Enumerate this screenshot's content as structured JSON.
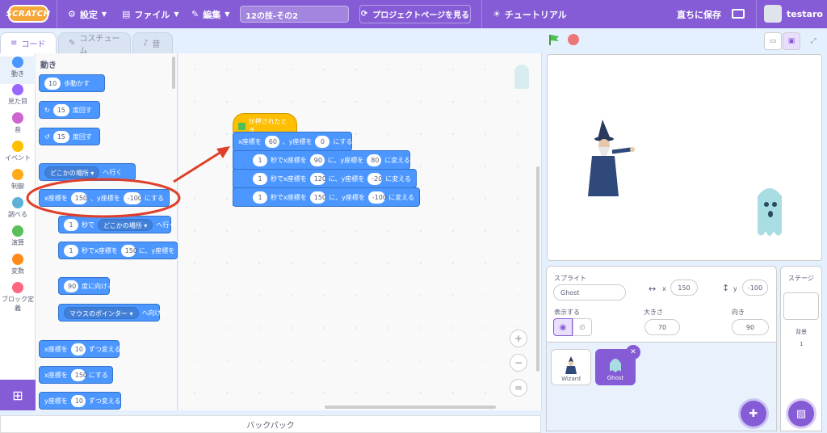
{
  "menubar": {
    "logo": "SCRATCH",
    "settings": "設定",
    "file": "ファイル",
    "edit": "編集",
    "project_title": "12の技-その2",
    "project_page": "プロジェクトページを見る",
    "tutorial": "チュートリアル",
    "save_now": "直ちに保存",
    "username": "testaro"
  },
  "tabs": {
    "code": "コード",
    "costume": "コスチューム",
    "sound": "音"
  },
  "categories": [
    {
      "label": "動き",
      "color": "#4c97ff"
    },
    {
      "label": "見た目",
      "color": "#9966ff"
    },
    {
      "label": "音",
      "color": "#cf63cf"
    },
    {
      "label": "イベント",
      "color": "#ffbf00"
    },
    {
      "label": "制御",
      "color": "#ffab19"
    },
    {
      "label": "調べる",
      "color": "#5cb1d6"
    },
    {
      "label": "演算",
      "color": "#59c059"
    },
    {
      "label": "変数",
      "color": "#ff8c1a"
    },
    {
      "label": "ブロック定義",
      "color": "#ff6680"
    }
  ],
  "palette": {
    "heading": "動き",
    "blocks": {
      "move": {
        "value": "10",
        "text": "歩動かす"
      },
      "turn_right": {
        "value": "15",
        "text": "度回す"
      },
      "turn_left": {
        "value": "15",
        "text": "度回す"
      },
      "goto": {
        "dropdown": "どこかの場所",
        "text": "へ行く"
      },
      "goto_xy": {
        "x_label": "x座標を",
        "x": "150",
        "mid": "、y座標を",
        "y": "-100",
        "end": "にする"
      },
      "glide": {
        "value": "1",
        "text": "秒で",
        "dropdown": "どこかの場所",
        "end": "へ行く"
      },
      "glide_xy": {
        "value": "1",
        "text": "秒でx座標を",
        "x": "150",
        "mid": "に、y座標を"
      },
      "point": {
        "value": "90",
        "text": "度に向ける"
      },
      "point_towards": {
        "dropdown": "マウスのポインター",
        "text": "へ向ける"
      },
      "change_x": {
        "label": "x座標を",
        "value": "10",
        "text": "ずつ変える"
      },
      "set_x": {
        "label": "x座標を",
        "value": "150",
        "text": "にする"
      },
      "change_y": {
        "label": "y座標を",
        "value": "10",
        "text": "ずつ変える"
      }
    }
  },
  "script": {
    "hat": "が押されたとき",
    "goto_xy": {
      "x_label": "x座標を",
      "x": "60",
      "mid": "、y座標を",
      "y": "0",
      "end": "にする"
    },
    "glides": [
      {
        "secs": "1",
        "t1": "秒でx座標を",
        "x": "90",
        "t2": "に、y座標を",
        "y": "80",
        "t3": "に変える"
      },
      {
        "secs": "1",
        "t1": "秒でx座標を",
        "x": "120",
        "t2": "に、y座標を",
        "y": "-20",
        "t3": "に変える"
      },
      {
        "secs": "1",
        "t1": "秒でx座標を",
        "x": "150",
        "t2": "に、y座標を",
        "y": "-100",
        "t3": "に変える"
      }
    ]
  },
  "backpack": "バックパック",
  "sprite_info": {
    "sprite_label": "スプライト",
    "sprite_name": "Ghost",
    "x_label": "x",
    "x": "150",
    "y_label": "y",
    "y": "-100",
    "show_label": "表示する",
    "size_label": "大きさ",
    "size": "70",
    "direction_label": "向き",
    "direction": "90"
  },
  "sprites": [
    {
      "name": "Wizard"
    },
    {
      "name": "Ghost"
    }
  ],
  "stage_panel": {
    "title": "ステージ",
    "backdrop_label": "背景",
    "backdrop_count": "1"
  }
}
